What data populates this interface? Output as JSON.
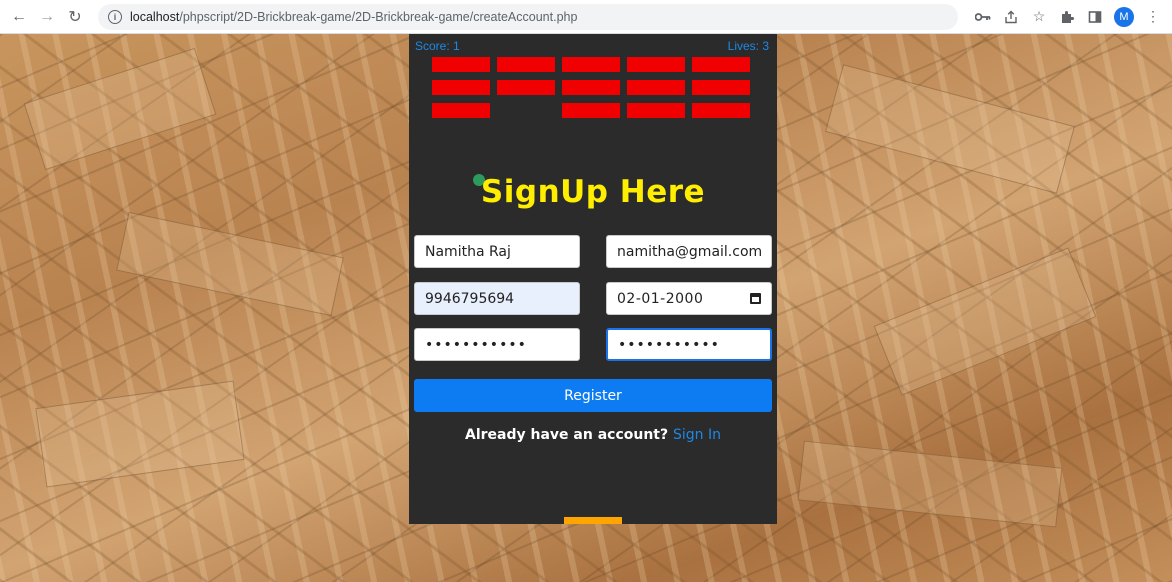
{
  "browser": {
    "url_host": "localhost",
    "url_path": "/phpscript/2D-Brickbreak-game/2D-Brickbreak-game/createAccount.php",
    "profile_initial": "M",
    "icons": [
      "back-icon",
      "forward-icon",
      "reload-icon",
      "info-icon",
      "key-icon",
      "share-icon",
      "star-icon",
      "extensions-icon",
      "sidepanel-icon",
      "profile-avatar",
      "menu-icon"
    ]
  },
  "game": {
    "score_label": "Score: 1",
    "lives_label": "Lives: 3",
    "brick_color": "#f00000",
    "paddle_color": "#ffa500",
    "bricks": [
      {
        "row": 0,
        "col": 0,
        "visible": true
      },
      {
        "row": 0,
        "col": 1,
        "visible": true
      },
      {
        "row": 0,
        "col": 2,
        "visible": true
      },
      {
        "row": 0,
        "col": 3,
        "visible": true
      },
      {
        "row": 0,
        "col": 4,
        "visible": true
      },
      {
        "row": 1,
        "col": 0,
        "visible": true
      },
      {
        "row": 1,
        "col": 1,
        "visible": true
      },
      {
        "row": 1,
        "col": 2,
        "visible": true
      },
      {
        "row": 1,
        "col": 3,
        "visible": true
      },
      {
        "row": 1,
        "col": 4,
        "visible": true
      },
      {
        "row": 2,
        "col": 0,
        "visible": true
      },
      {
        "row": 2,
        "col": 1,
        "visible": false
      },
      {
        "row": 2,
        "col": 2,
        "visible": true
      },
      {
        "row": 2,
        "col": 3,
        "visible": true
      },
      {
        "row": 2,
        "col": 4,
        "visible": true
      }
    ]
  },
  "form": {
    "title": "SignUp Here",
    "title_color": "#ffee00",
    "name_value": "Namitha Raj",
    "email_value": "namitha@gmail.com",
    "phone_value": "9946795694",
    "dob_value": "02-01-2000",
    "password_value": "•••••••••••",
    "confirm_password_value": "•••••••••••",
    "register_label": "Register",
    "register_color": "#0d7cf2",
    "signin_prompt": "Already have an account?",
    "signin_link": "Sign In"
  }
}
